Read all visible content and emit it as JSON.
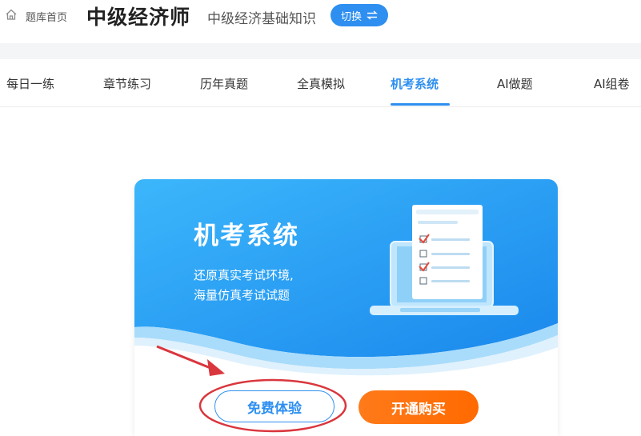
{
  "header": {
    "home_label": "题库首页",
    "title": "中级经济师",
    "subject": "中级经济基础知识",
    "switch_label": "切换",
    "switch_icon": "swap-arrows-icon"
  },
  "tabs": [
    {
      "label": "每日一练",
      "active": false
    },
    {
      "label": "章节练习",
      "active": false
    },
    {
      "label": "历年真题",
      "active": false
    },
    {
      "label": "全真模拟",
      "active": false
    },
    {
      "label": "机考系统",
      "active": true
    },
    {
      "label": "AI做题",
      "active": false
    },
    {
      "label": "AI组卷",
      "active": false
    }
  ],
  "card": {
    "title": "机考系统",
    "desc_line1": "还原真实考试环境,",
    "desc_line2": "海量仿真考试试题",
    "free_button": "免费体验",
    "buy_button": "开通购买"
  },
  "colors": {
    "accent": "#2e8ff0",
    "buy": "#ff6a00",
    "annotation": "#d9363e"
  }
}
